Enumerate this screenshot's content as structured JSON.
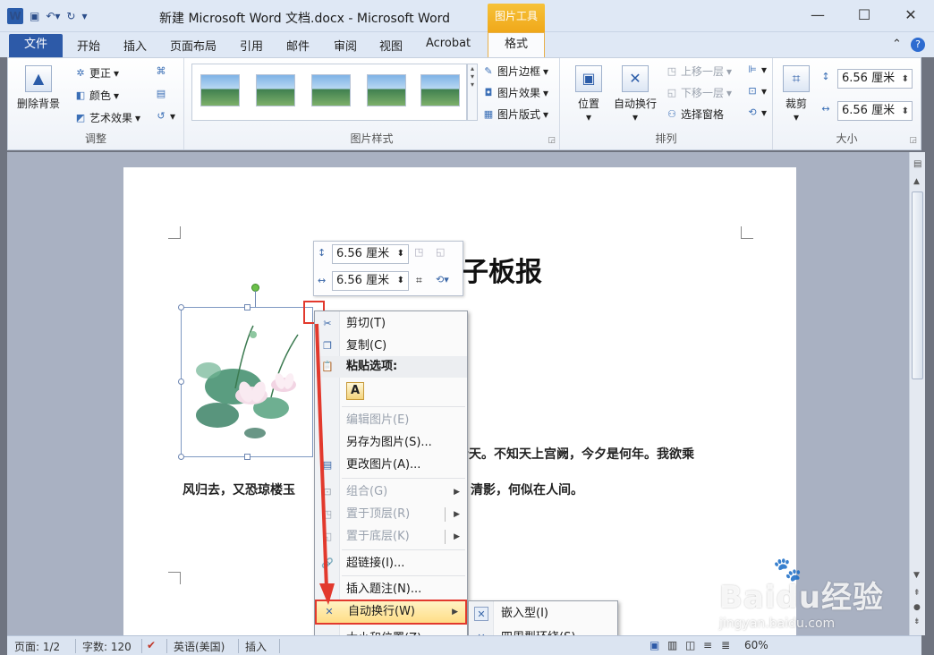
{
  "window": {
    "title": "新建 Microsoft Word 文档.docx - Microsoft Word",
    "context_tool": "图片工具",
    "controls": [
      "—",
      "☐",
      "✕"
    ]
  },
  "tabs": {
    "file": "文件",
    "items": [
      "开始",
      "插入",
      "页面布局",
      "引用",
      "邮件",
      "审阅",
      "视图",
      "Acrobat"
    ],
    "active": "格式"
  },
  "ribbon": {
    "adjust": {
      "label": "调整",
      "remove_bg": "删除背景",
      "correct": "更正",
      "color": "颜色",
      "art": "艺术效果"
    },
    "styles": {
      "label": "图片样式",
      "border": "图片边框",
      "effect": "图片效果",
      "layout": "图片版式"
    },
    "arrange": {
      "label": "排列",
      "position": "位置",
      "wrap": "自动换行",
      "forward": "上移一层",
      "backward": "下移一层",
      "pane": "选择窗格"
    },
    "size": {
      "label": "大小",
      "crop": "裁剪",
      "height": "6.56 厘米",
      "width": "6.56 厘米"
    }
  },
  "document": {
    "title": "子板报",
    "line1": "青天。不知天上宫阙，今夕是何年。我欲乘",
    "line2_left": "风归去，又恐琼楼玉",
    "line2_right": "清影，何似在人间。"
  },
  "minibar": {
    "height": "6.56 厘米",
    "width": "6.56 厘米"
  },
  "context_menu": {
    "cut": "剪切(T)",
    "copy": "复制(C)",
    "paste_header": "粘贴选项:",
    "paste_a": "A",
    "edit_picture": "编辑图片(E)",
    "save_as_picture": "另存为图片(S)...",
    "change_picture": "更改图片(A)...",
    "group": "组合(G)",
    "bring_to_front": "置于顶层(R)",
    "send_to_back": "置于底层(K)",
    "hyperlink": "超链接(I)...",
    "insert_caption": "插入题注(N)...",
    "wrap_text": "自动换行(W)",
    "size_position": "大小和位置(Z)..."
  },
  "submenu": {
    "inline": "嵌入型(I)",
    "square": "四周型环绕(S)"
  },
  "status": {
    "page": "页面: 1/2",
    "words": "字数: 120",
    "language": "英语(美国)",
    "insert": "插入",
    "zoom": "60%"
  },
  "watermark": {
    "main": "Baidu经验",
    "sub": "jingyan.baidu.com"
  },
  "colors": {
    "accent": "#2d5aa8",
    "highlight": "#e2392d",
    "context_tab": "#f0a81a"
  }
}
